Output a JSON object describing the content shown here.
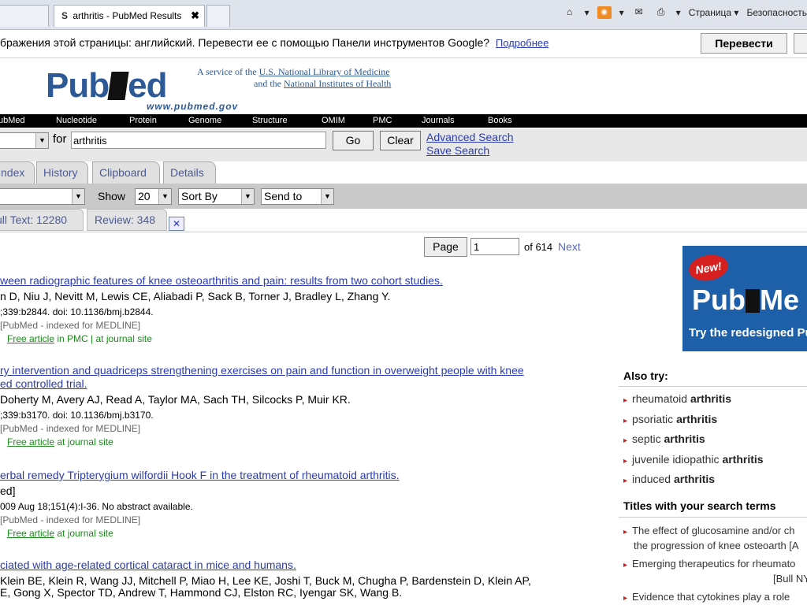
{
  "browser": {
    "tab1_label": "",
    "tab2_label": "arthritis - PubMed Results",
    "tab2_icon": "S",
    "tab2_close": "✖",
    "tab3_label": "",
    "toolbar_page": "Страница ▾",
    "toolbar_security": "Безопасность"
  },
  "translate": {
    "message": "бражения этой страницы: английский. Перевести ее с помощью Панели инструментов Google?",
    "more_link": "Подробнее",
    "button": "Перевести"
  },
  "header": {
    "logo_left": "Pub",
    "logo_right": "ed",
    "logo_url": "www.pubmed.gov",
    "service_prefix": "A service of the",
    "service_nlm": "U.S. National Library of Medicine",
    "service_and": "and the",
    "service_nih": "National Institutes of Health"
  },
  "nav": [
    "ubMed",
    "Nucleotide",
    "Protein",
    "Genome",
    "Structure",
    "OMIM",
    "PMC",
    "Journals",
    "Books"
  ],
  "search": {
    "for_label": "for",
    "query": "arthritis",
    "go": "Go",
    "clear": "Clear",
    "advanced": "Advanced Search",
    "save": "Save Search"
  },
  "tabs": [
    "ndex",
    "History",
    "Clipboard",
    "Details"
  ],
  "display": {
    "show_label": "Show",
    "show_value": "20",
    "sort_by": "Sort By",
    "send_to": "Send to"
  },
  "filters": [
    "ull Text: 12280",
    "Review: 348"
  ],
  "paging": {
    "page_label": "Page",
    "page_value": "1",
    "of_total": "of 614",
    "next": "Next"
  },
  "results": [
    {
      "title": "ween radiographic features of knee osteoarthritis and pain: results from two cohort studies.",
      "title2": "",
      "authors": "n D, Niu J, Nevitt M, Lewis CE, Aliabadi P, Sack B, Torner J, Bradley L, Zhang Y.",
      "authors2": "",
      "cite": ";339:b2844. doi: 10.1136/bmj.b2844.",
      "status": "[PubMed - indexed for MEDLINE]",
      "free": "Free article",
      "links_rest": " in PMC | at journal site"
    },
    {
      "title": "ry intervention and quadriceps strengthening exercises on pain and function in overweight people with knee",
      "title2": "ed controlled trial.",
      "authors": "Doherty M, Avery AJ, Read A, Taylor MA, Sach TH, Silcocks P, Muir KR.",
      "authors2": "",
      "cite": ";339:b3170. doi: 10.1136/bmj.b3170.",
      "status": "[PubMed - indexed for MEDLINE]",
      "free": "Free article",
      "links_rest": " at journal site"
    },
    {
      "title": "erbal remedy Tripterygium wilfordii Hook F in the treatment of rheumatoid arthritis.",
      "title2": "",
      "authors": "ed]",
      "authors2": "",
      "cite": "009 Aug 18;151(4):I-36. No abstract available.",
      "status": "[PubMed - indexed for MEDLINE]",
      "free": "Free article",
      "links_rest": " at journal site"
    },
    {
      "title": "ciated with age-related cortical cataract in mice and humans.",
      "title2": "",
      "authors": "Klein BE, Klein R, Wang JJ, Mitchell P, Miao H, Lee KE, Joshi T, Buck M, Chugha P, Bardenstein D, Klein AP,",
      "authors2": "E, Gong X, Spector TD, Andrew T, Hammond CJ, Elston RC, Iyengar SK, Wang B.",
      "cite": "",
      "status": "",
      "free": "",
      "links_rest": ""
    }
  ],
  "sidebar": {
    "ad_new": "New!",
    "ad_logo_left": "Pub",
    "ad_logo_right": "Me",
    "ad_tag": "Try the redesigned Pu",
    "also_try_title": "Also try:",
    "also_try": [
      {
        "pre": "rheumatoid ",
        "bold": "arthritis"
      },
      {
        "pre": "psoriatic ",
        "bold": "arthritis"
      },
      {
        "pre": "septic ",
        "bold": "arthritis"
      },
      {
        "pre": "juvenile idiopathic ",
        "bold": "arthritis"
      },
      {
        "pre": "induced ",
        "bold": "arthritis"
      }
    ],
    "titles_title": "Titles with your search terms",
    "titles": [
      {
        "l1": "The effect of glucosamine and/or ch",
        "l2": "the progression of knee osteoarth [A"
      },
      {
        "l1": "Emerging therapeutics for rheumato",
        "l2": "[Bull NY"
      },
      {
        "l1": "Evidence that cytokines play a role",
        "l2": ""
      }
    ]
  }
}
